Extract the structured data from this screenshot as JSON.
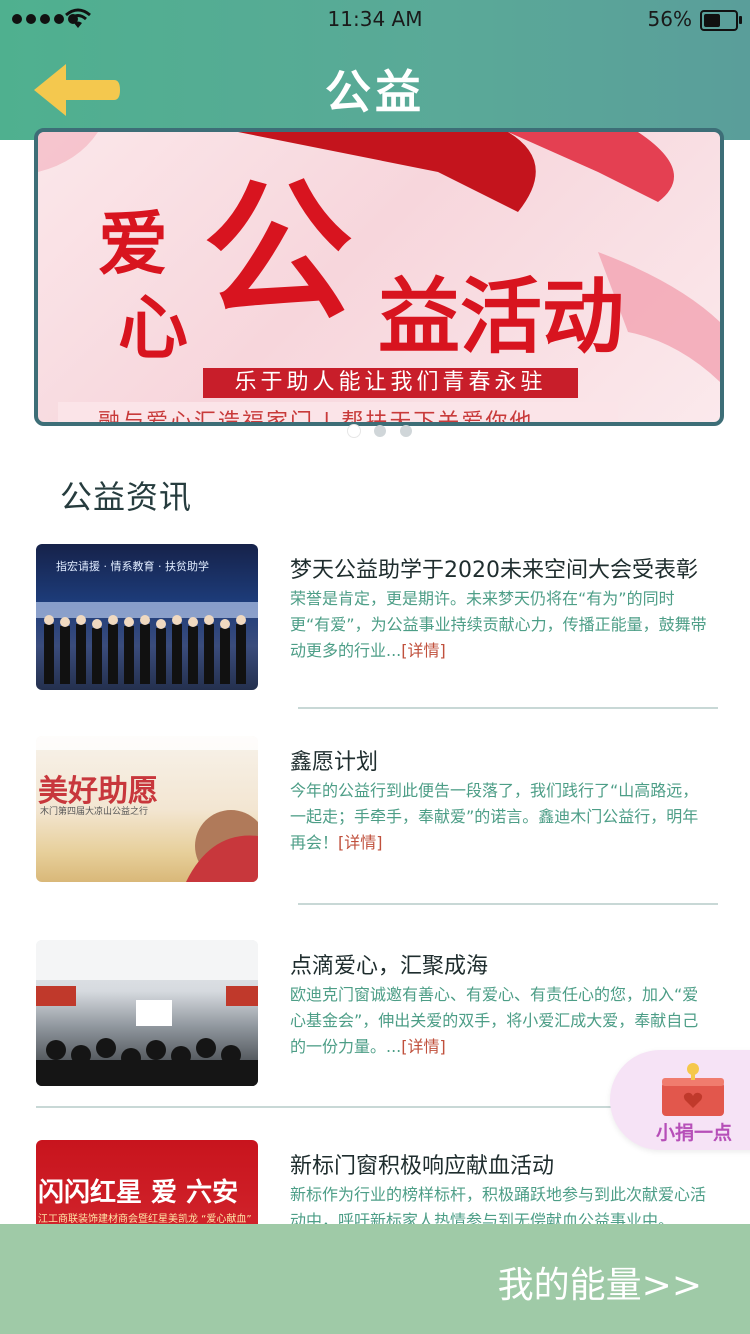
{
  "status_bar": {
    "time": "11:34 AM",
    "battery": "56%"
  },
  "header": {
    "title": "公益",
    "back_icon": "arrow-left-icon"
  },
  "banner": {
    "big_chars_left": [
      "爱",
      "心"
    ],
    "big_main": "公",
    "big_rest": "益活动",
    "subtitle": "乐于助人能让我们青春永驻",
    "bottom_partial": "融与爱心汇造福家门 | 帮扶天下关爱你他",
    "dots": 3,
    "active_dot": 0
  },
  "section": {
    "title": "公益资讯"
  },
  "news": [
    {
      "title": "梦天公益助学于2020未来空间大会受表彰",
      "desc": "荣誉是肯定，更是期许。未来梦天仍将在“有为”的同时更“有爱”，为公益事业持续贡献心力，传播正能量，鼓舞带动更多的行业...",
      "more": "[详情]",
      "thumb_text": "指宏请援 · 情系教育 · 扶贫助学"
    },
    {
      "title": "鑫愿计划",
      "desc": "今年的公益行到此便告一段落了，我们践行了“山高路远，一起走；手牵手，奉献爱”的诺言。鑫迪木门公益行，明年再会！",
      "more": "[详情]",
      "thumb_text": "美好助愿",
      "thumb_sub": "木门第四届大凉山公益之行"
    },
    {
      "title": "点滴爱心，汇聚成海",
      "desc": "欧迪克门窗诚邀有善心、有爱心、有责任心的您，加入“爱心基金会”，伸出关爱的双手，将小爱汇成大爱，奉献自己的一份力量。...",
      "more": "[详情]"
    },
    {
      "title": "新标门窗积极响应献血活动",
      "desc": "新标作为行业的榜样标杆，积极踊跃地参与到此次献爱心活动中，呼吁新标家人热情参与到无偿献血公益事业中。",
      "more": "",
      "thumb_text": "闪闪红星 爱 六安",
      "thumb_sub": "江工商联装饰建材商会暨红星美凯龙 “爱心献血”"
    }
  ],
  "donate": {
    "label": "小捐一点"
  },
  "bottom": {
    "label": "我的能量>>"
  },
  "colors": {
    "header": "#52ab93",
    "bottom_bar": "#9fcaa7",
    "desc_text": "#4d9e87",
    "more_link": "#c0503c"
  }
}
